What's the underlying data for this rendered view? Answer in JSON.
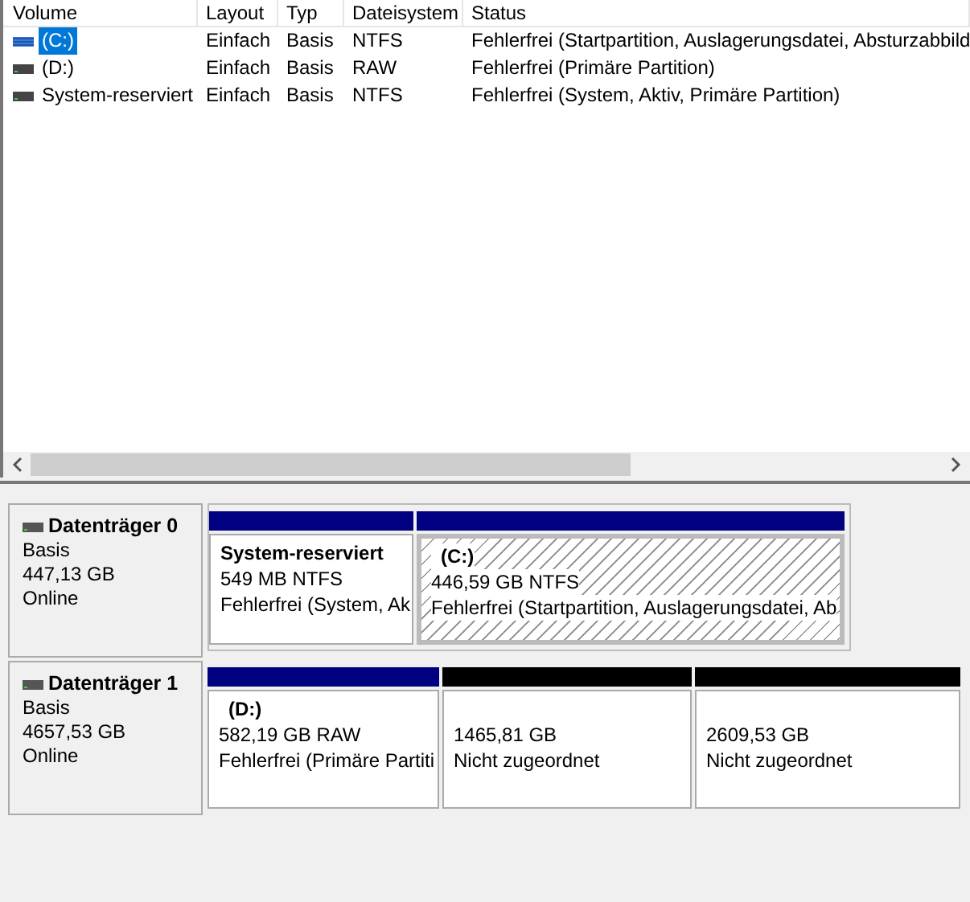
{
  "columns": [
    "Volume",
    "Layout",
    "Typ",
    "Dateisystem",
    "Status"
  ],
  "volumes": [
    {
      "name": "(C:)",
      "selected": true,
      "cells": [
        "Einfach",
        "Basis",
        "NTFS",
        "Fehlerfrei (Startpartition, Auslagerungsdatei, Absturzabbild"
      ]
    },
    {
      "name": "(D:)",
      "selected": false,
      "cells": [
        "Einfach",
        "Basis",
        "RAW",
        "Fehlerfrei (Primäre Partition)"
      ]
    },
    {
      "name": "System-reserviert",
      "selected": false,
      "cells": [
        "Einfach",
        "Basis",
        "NTFS",
        "Fehlerfrei (System, Aktiv, Primäre Partition)"
      ]
    }
  ],
  "disks": [
    {
      "name": "Datenträger 0",
      "type": "Basis",
      "size": "447,13 GB",
      "state": "Online",
      "partitions": [
        {
          "kind": "primary",
          "selected": false,
          "name": "System-reserviert",
          "size": "549 MB NTFS",
          "status": "Fehlerfrei (System, Ak"
        },
        {
          "kind": "primary",
          "selected": true,
          "name": "(C:)",
          "size": "446,59 GB NTFS",
          "status": "Fehlerfrei (Startpartition, Auslagerungsdatei, Ab"
        }
      ]
    },
    {
      "name": "Datenträger 1",
      "type": "Basis",
      "size": "4657,53 GB",
      "state": "Online",
      "partitions": [
        {
          "kind": "primary",
          "selected": false,
          "name": "(D:)",
          "size": "582,19 GB RAW",
          "status": "Fehlerfrei (Primäre Partiti"
        },
        {
          "kind": "unallocated",
          "selected": false,
          "size": "1465,81 GB",
          "status": "Nicht zugeordnet"
        },
        {
          "kind": "unallocated",
          "selected": false,
          "size": "2609,53 GB",
          "status": "Nicht zugeordnet"
        }
      ]
    }
  ]
}
